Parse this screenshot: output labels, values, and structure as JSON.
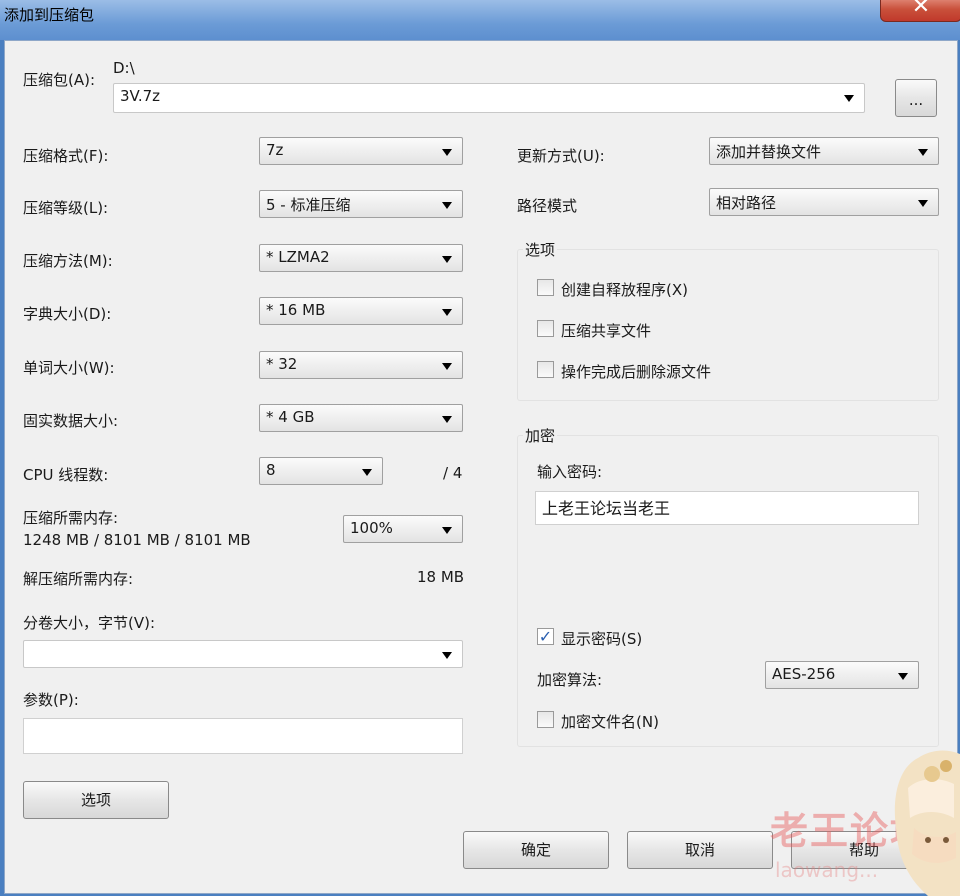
{
  "window": {
    "title": "添加到压缩包",
    "close_symbol": "✕"
  },
  "archive": {
    "label": "压缩包(A):",
    "path": "D:\\",
    "filename": "3V.7z",
    "browse_label": "..."
  },
  "left": {
    "format": {
      "label": "压缩格式(F):",
      "value": "7z"
    },
    "level": {
      "label": "压缩等级(L):",
      "value": "5 - 标准压缩"
    },
    "method": {
      "label": "压缩方法(M):",
      "value": "* LZMA2"
    },
    "dict": {
      "label": "字典大小(D):",
      "value": "* 16 MB"
    },
    "word": {
      "label": "单词大小(W):",
      "value": "* 32"
    },
    "solid": {
      "label": "固实数据大小:",
      "value": "* 4 GB"
    },
    "threads": {
      "label": "CPU 线程数:",
      "value": "8",
      "max": "/ 4"
    },
    "mem_compress": {
      "label": "压缩所需内存:",
      "detail": "1248 MB / 8101 MB / 8101 MB",
      "percent": "100%"
    },
    "mem_decompress": {
      "label": "解压缩所需内存:",
      "value": "18 MB"
    },
    "volume": {
      "label": "分卷大小，字节(V):",
      "value": ""
    },
    "params": {
      "label": "参数(P):",
      "value": ""
    },
    "options_button": "选项"
  },
  "right": {
    "update": {
      "label": "更新方式(U):",
      "value": "添加并替换文件"
    },
    "path_mode": {
      "label": "路径模式",
      "value": "相对路径"
    },
    "options_group": {
      "title": "选项",
      "items": [
        {
          "label": "创建自释放程序(X)",
          "checked": false
        },
        {
          "label": "压缩共享文件",
          "checked": false
        },
        {
          "label": "操作完成后删除源文件",
          "checked": false
        }
      ]
    },
    "encryption": {
      "title": "加密",
      "password_label": "输入密码:",
      "password_value": "上老王论坛当老王",
      "show_password_label": "显示密码(S)",
      "show_password_checked": true,
      "method_label": "加密算法:",
      "method_value": "AES-256",
      "encrypt_names_label": "加密文件名(N)",
      "encrypt_names_checked": false
    }
  },
  "buttons": {
    "ok": "确定",
    "cancel": "取消",
    "help": "帮助"
  },
  "overlay": {
    "watermark": "老王论坛",
    "watermark_sub": "laowang..."
  },
  "colors": {
    "title_bar": "#6b9bd6",
    "close": "#c0392b",
    "dialog_bg": "#f0f0f0",
    "check": "#2a5fb0"
  }
}
